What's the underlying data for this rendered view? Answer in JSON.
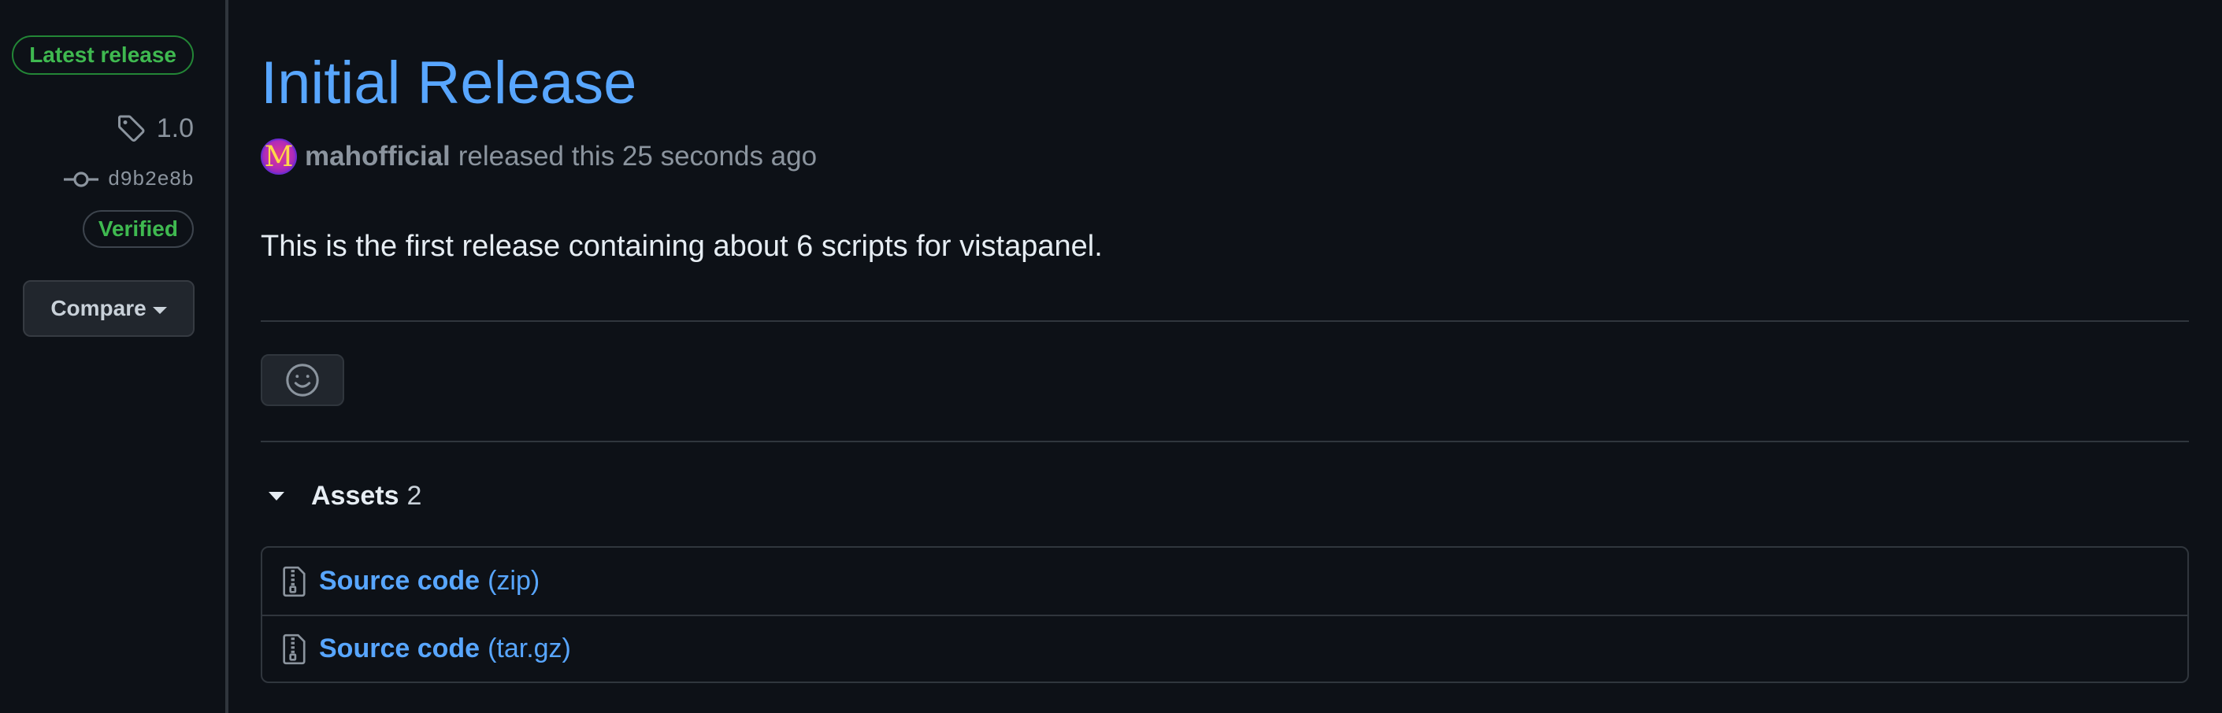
{
  "sidebar": {
    "latest_badge": "Latest release",
    "tag": "1.0",
    "tag_icon": "tag-icon",
    "commit": "d9b2e8b",
    "commit_icon": "git-commit-icon",
    "verified_badge": "Verified",
    "compare_label": "Compare"
  },
  "release": {
    "title": "Initial Release",
    "avatar_letter": "M",
    "author": "mahofficial",
    "released_text": "released this 25 seconds ago",
    "description": "This is the first release containing about 6 scripts for vistapanel."
  },
  "reactions": {
    "icon": "smiley-icon"
  },
  "assets": {
    "label": "Assets",
    "count": "2",
    "items": [
      {
        "name": "Source code",
        "format": "(zip)",
        "icon": "file-zip-icon"
      },
      {
        "name": "Source code",
        "format": "(tar.gz)",
        "icon": "file-zip-icon"
      }
    ]
  },
  "colors": {
    "background": "#0d1117",
    "link": "#58a6ff",
    "success": "#3fb950",
    "border": "#30363d"
  }
}
